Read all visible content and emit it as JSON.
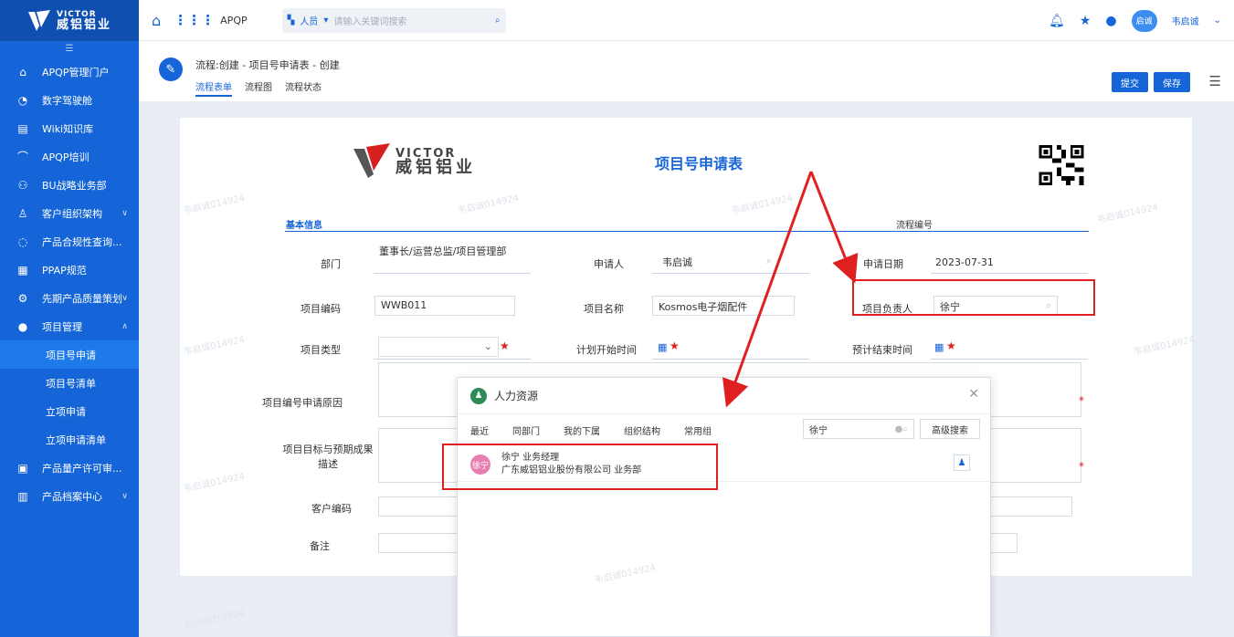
{
  "sidebar": {
    "logo_en": "VICTOR",
    "logo_cn": "威铝铝业",
    "collapse": "☰",
    "items": [
      {
        "label": "APQP管理门户",
        "icon": "home-outline-icon"
      },
      {
        "label": "数字驾驶舱",
        "icon": "dashboard-icon"
      },
      {
        "label": "Wiki知识库",
        "icon": "book-icon"
      },
      {
        "label": "APQP培训",
        "icon": "graduation-icon"
      },
      {
        "label": "BU战略业务部",
        "icon": "org-icon"
      },
      {
        "label": "客户组织架构",
        "icon": "people-icon"
      },
      {
        "label": "产品合规性查询...",
        "icon": "search-shield-icon"
      },
      {
        "label": "PPAP规范",
        "icon": "document-icon"
      },
      {
        "label": "先期产品质量策划",
        "icon": "gear-icon"
      },
      {
        "label": "项目管理",
        "icon": "user-icon"
      }
    ],
    "subitems": [
      "项目号申请",
      "项目号清单",
      "立项申请",
      "立项申请清单"
    ],
    "bottom_items": [
      {
        "label": "产品量产许可审...",
        "icon": "chart-icon"
      },
      {
        "label": "产品档案中心",
        "icon": "archive-icon"
      }
    ]
  },
  "topbar": {
    "app_name": "APQP",
    "search_type": "人员",
    "search_placeholder": "请输入关键词搜索",
    "avatar": "启诚",
    "user": "韦启诚"
  },
  "process": {
    "title": "流程:创建 - 项目号申请表 - 创建",
    "tabs": [
      "流程表单",
      "流程图",
      "流程状态"
    ],
    "submit": "提交",
    "save": "保存"
  },
  "form": {
    "logo_en": "VICTOR",
    "logo_cn": "威铝铝业",
    "title": "项目号申请表",
    "section": "基本信息",
    "flow_no_label": "流程编号",
    "dept_label": "部门",
    "dept_value": "董事长/运营总监/项目管理部",
    "applicant_label": "申请人",
    "applicant_value": "韦启诚",
    "apply_date_label": "申请日期",
    "apply_date_value": "2023-07-31",
    "code_label": "项目编码",
    "code_value": "WWB011",
    "name_label": "项目名称",
    "name_value": "Kosmos电子烟配件",
    "owner_label": "项目负责人",
    "owner_value": "徐宁",
    "type_label": "项目类型",
    "start_label": "计划开始时间",
    "end_label": "预计结束时间",
    "reason_label": "项目编号申请原因",
    "goal_label": "项目目标与预期成果描述",
    "cust_label": "客户编码",
    "remark_label": "备注"
  },
  "dialog": {
    "title": "人力资源",
    "tabs": [
      "最近",
      "同部门",
      "我的下属",
      "组织结构",
      "常用组"
    ],
    "search_value": "徐宁",
    "advanced": "高级搜索",
    "result": {
      "avatar": "徐宁",
      "name": "徐宁  业务经理",
      "org": "广东威铝铝业股份有限公司  业务部"
    }
  },
  "watermark": "韦启诚014924",
  "colors": {
    "primary": "#1565d8",
    "annotation": "#e02020"
  }
}
